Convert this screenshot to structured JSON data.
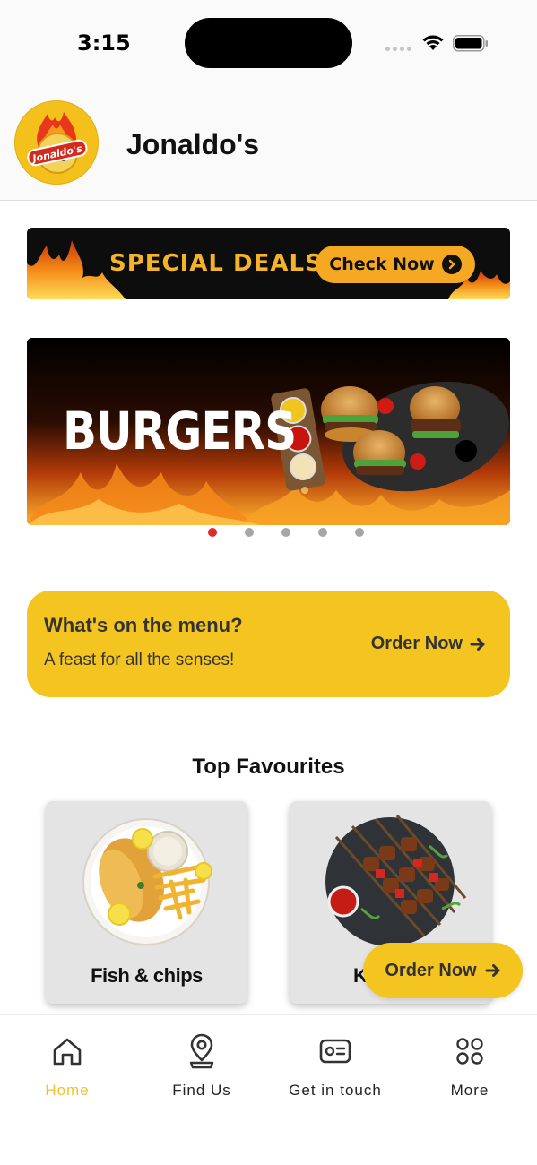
{
  "status_bar": {
    "time": "3:15"
  },
  "header": {
    "title": "Jonaldo's",
    "logo_text": "Jonaldo's"
  },
  "deals_banner": {
    "text": "SPECIAL DEALS",
    "button_label": "Check Now"
  },
  "carousel": {
    "slide_text": "BURGERS",
    "slide_count": 5,
    "active_index": 0
  },
  "menu_card": {
    "title": "What's on the menu?",
    "subtitle": "A feast for all the senses!",
    "action_label": "Order Now"
  },
  "favourites": {
    "title": "Top Favourites",
    "items": [
      {
        "label": "Fish & chips"
      },
      {
        "label": "K"
      }
    ]
  },
  "floating_button": {
    "label": "Order Now"
  },
  "tab_bar": {
    "items": [
      {
        "label": "Home",
        "icon": "home-icon",
        "active": true
      },
      {
        "label": "Find Us",
        "icon": "location-pin-icon",
        "active": false
      },
      {
        "label": "Get in touch",
        "icon": "contact-card-icon",
        "active": false
      },
      {
        "label": "More",
        "icon": "grid-dots-icon",
        "active": false
      }
    ]
  },
  "colors": {
    "accent_yellow": "#f4c421",
    "deal_orange": "#f5a821",
    "active_tab": "#f2c12a",
    "active_dot": "#e3282b"
  }
}
